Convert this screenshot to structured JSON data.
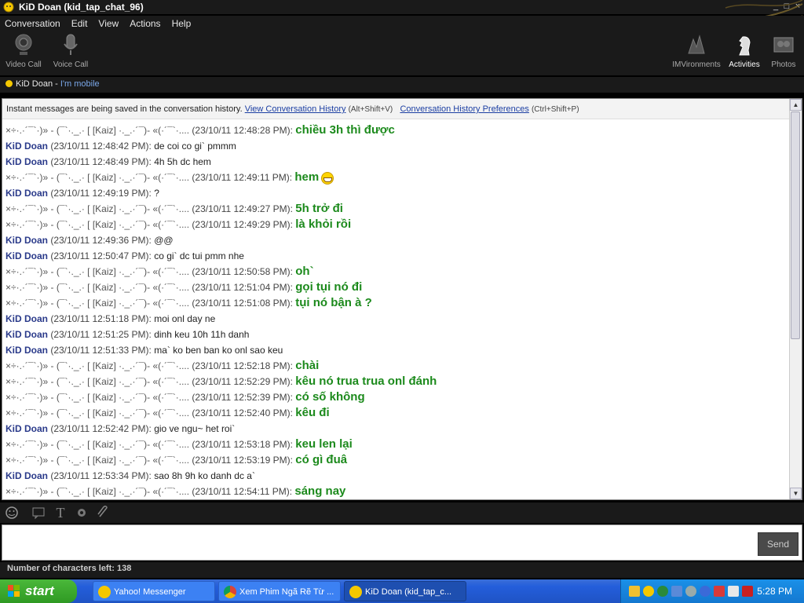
{
  "window": {
    "title": "KiD  Doan (kid_tap_chat_96)",
    "controls": [
      "_",
      "□",
      "×"
    ]
  },
  "menu": [
    "Conversation",
    "Edit",
    "View",
    "Actions",
    "Help"
  ],
  "toolbar": {
    "video_call": "Video Call",
    "voice_call": "Voice Call",
    "imvironments": "IMVironments",
    "activities": "Activities",
    "photos": "Photos"
  },
  "status": {
    "name": "KiD  Doan",
    "separator": " - ",
    "message": "I'm mobile",
    "color": "#f5c800"
  },
  "history_notice": {
    "text": "Instant messages are being saved in the conversation history.",
    "link1": "View Conversation History",
    "shortcut1": "(Alt+Shift+V)",
    "link2": "Conversation History Preferences",
    "shortcut2": "(Ctrl+Shift+P)"
  },
  "kaiz_name": "×÷·.·´¯`·)» - (¯`·._.· [ [Kaiz] ·._.·´¯)- «(·´¯`·.... ",
  "kid_name": "KiD Doan",
  "messages": [
    {
      "from": "kaiz",
      "time": "(23/10/11 12:48:28 PM): ",
      "text": "chiều 3h thì được"
    },
    {
      "from": "kid",
      "time": " (23/10/11 12:48:42 PM): ",
      "text": "de coi co gi` pmmm"
    },
    {
      "from": "kid",
      "time": " (23/10/11 12:48:49 PM): ",
      "text": "4h 5h dc hem"
    },
    {
      "from": "kaiz",
      "time": "(23/10/11 12:49:11 PM): ",
      "text": "hem",
      "emoji": true
    },
    {
      "from": "kid",
      "time": " (23/10/11 12:49:19 PM): ",
      "text": "?"
    },
    {
      "from": "kaiz",
      "time": "(23/10/11 12:49:27 PM): ",
      "text": "5h trở đi"
    },
    {
      "from": "kaiz",
      "time": "(23/10/11 12:49:29 PM): ",
      "text": "là khỏi rồi"
    },
    {
      "from": "kid",
      "time": " (23/10/11 12:49:36 PM): ",
      "text": "@@"
    },
    {
      "from": "kid",
      "time": " (23/10/11 12:50:47 PM): ",
      "text": "co gi` dc tui pmm nhe"
    },
    {
      "from": "kaiz",
      "time": "(23/10/11 12:50:58 PM): ",
      "text": "oh`"
    },
    {
      "from": "kaiz",
      "time": "(23/10/11 12:51:04 PM): ",
      "text": "gọi tụi nó đi"
    },
    {
      "from": "kaiz",
      "time": "(23/10/11 12:51:08 PM): ",
      "text": "tụi nó bận à ?"
    },
    {
      "from": "kid",
      "time": " (23/10/11 12:51:18 PM): ",
      "text": "moi onl day ne"
    },
    {
      "from": "kid",
      "time": " (23/10/11 12:51:25 PM): ",
      "text": "dinh keu 10h 11h danh"
    },
    {
      "from": "kid",
      "time": " (23/10/11 12:51:33 PM): ",
      "text": "ma` ko ben ban ko onl sao keu"
    },
    {
      "from": "kaiz",
      "time": "(23/10/11 12:52:18 PM): ",
      "text": "chài"
    },
    {
      "from": "kaiz",
      "time": "(23/10/11 12:52:29 PM): ",
      "text": "kêu nó trua trua onl đánh"
    },
    {
      "from": "kaiz",
      "time": "(23/10/11 12:52:39 PM): ",
      "text": "có số không"
    },
    {
      "from": "kaiz",
      "time": "(23/10/11 12:52:40 PM): ",
      "text": "kêu đi"
    },
    {
      "from": "kid",
      "time": " (23/10/11 12:52:42 PM): ",
      "text": "gio ve ngu~ het roi`"
    },
    {
      "from": "kaiz",
      "time": "(23/10/11 12:53:18 PM): ",
      "text": "keu len lại"
    },
    {
      "from": "kaiz",
      "time": "(23/10/11 12:53:19 PM): ",
      "text": "có gì đuâ"
    },
    {
      "from": "kid",
      "time": " (23/10/11 12:53:34 PM): ",
      "text": "sao 8h 9h ko danh dc a`"
    },
    {
      "from": "kaiz",
      "time": "(23/10/11 12:54:11 PM): ",
      "text": "sáng nay"
    }
  ],
  "input": {
    "send_label": "Send",
    "char_count": "Number of characters left: 138"
  },
  "taskbar": {
    "start_label": "start",
    "tasks": [
      "Yahoo! Messenger",
      "Xem Phim Ngã Rẽ Từ ...",
      "KiD  Doan (kid_tap_c..."
    ],
    "clock": "5:28 PM"
  }
}
